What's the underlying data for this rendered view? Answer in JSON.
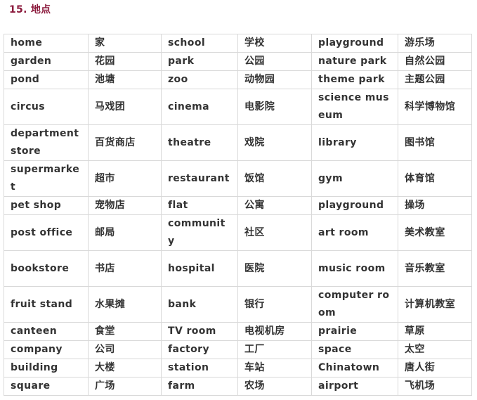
{
  "title": "15. 地点",
  "rows": [
    {
      "tall": false,
      "cells": [
        "home",
        "家",
        "school",
        "学校",
        "playground",
        "游乐场"
      ]
    },
    {
      "tall": false,
      "cells": [
        "garden",
        "花园",
        "park",
        "公园",
        "nature park",
        "自然公园"
      ]
    },
    {
      "tall": false,
      "cells": [
        "pond",
        "池塘",
        "zoo",
        "动物园",
        "theme park",
        "主题公园"
      ]
    },
    {
      "tall": true,
      "cells": [
        "circus",
        "马戏团",
        "cinema",
        "电影院",
        "science museum",
        "科学博物馆"
      ]
    },
    {
      "tall": true,
      "cells": [
        "department store",
        "百货商店",
        "theatre",
        "戏院",
        "library",
        "图书馆"
      ]
    },
    {
      "tall": true,
      "cells": [
        "supermarket",
        "超市",
        "restaurant",
        "饭馆",
        "gym",
        "体育馆"
      ]
    },
    {
      "tall": false,
      "cells": [
        "pet shop",
        "宠物店",
        "flat",
        "公寓",
        "playground",
        "操场"
      ]
    },
    {
      "tall": true,
      "cells": [
        "post office",
        "邮局",
        "community",
        "社区",
        "art room",
        "美术教室"
      ]
    },
    {
      "tall": true,
      "cells": [
        "bookstore",
        "书店",
        "hospital",
        "医院",
        "music room",
        "音乐教室"
      ]
    },
    {
      "tall": true,
      "cells": [
        "fruit stand",
        "水果摊",
        "bank",
        "银行",
        "computer room",
        "计算机教室"
      ]
    },
    {
      "tall": false,
      "cells": [
        "canteen",
        "食堂",
        "TV room",
        "电视机房",
        "prairie",
        "草原"
      ]
    },
    {
      "tall": false,
      "cells": [
        "company",
        "公司",
        "factory",
        "工厂",
        "space",
        "太空"
      ]
    },
    {
      "tall": false,
      "cells": [
        "building",
        "大楼",
        "station",
        "车站",
        "Chinatown",
        "唐人街"
      ]
    },
    {
      "tall": false,
      "cells": [
        "square",
        "广场",
        "farm",
        "农场",
        "airport",
        "飞机场"
      ]
    }
  ]
}
